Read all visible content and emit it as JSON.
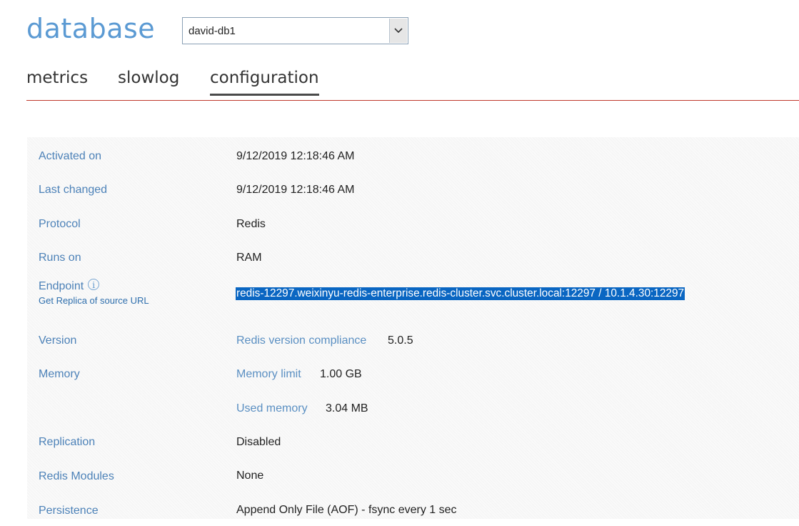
{
  "header": {
    "title": "database",
    "db_select": {
      "value": "david-db1",
      "arrow_icon": "chevron-down-icon"
    }
  },
  "tabs": [
    {
      "label": "metrics",
      "active": false
    },
    {
      "label": "slowlog",
      "active": false
    },
    {
      "label": "configuration",
      "active": true
    }
  ],
  "config": {
    "activated_on": {
      "label": "Activated on",
      "value": "9/12/2019 12:18:46 AM"
    },
    "last_changed": {
      "label": "Last changed",
      "value": "9/12/2019 12:18:46 AM"
    },
    "protocol": {
      "label": "Protocol",
      "value": "Redis"
    },
    "runs_on": {
      "label": "Runs on",
      "value": "RAM"
    },
    "endpoint": {
      "label": "Endpoint",
      "info_icon": "info-icon",
      "link": "Get Replica of source URL",
      "value": "redis-12297.weixinyu-redis-enterprise.redis-cluster.svc.cluster.local:12297 / 10.1.4.30:12297"
    },
    "version": {
      "label": "Version",
      "sublabel": "Redis version compliance",
      "value": "5.0.5"
    },
    "memory": {
      "label": "Memory",
      "limit_label": "Memory limit",
      "limit_value": "1.00 GB",
      "used_label": "Used memory",
      "used_value": "3.04 MB"
    },
    "replication": {
      "label": "Replication",
      "value": "Disabled"
    },
    "modules": {
      "label": "Redis Modules",
      "value": "None"
    },
    "persistence": {
      "label": "Persistence",
      "value": "Append Only File (AOF) - fsync every 1 sec"
    }
  },
  "colors": {
    "accent_blue": "#5b9ad3",
    "label_blue": "#4d82b8",
    "tab_underline_red": "#c0392b",
    "selection_blue": "#0a66c2"
  }
}
